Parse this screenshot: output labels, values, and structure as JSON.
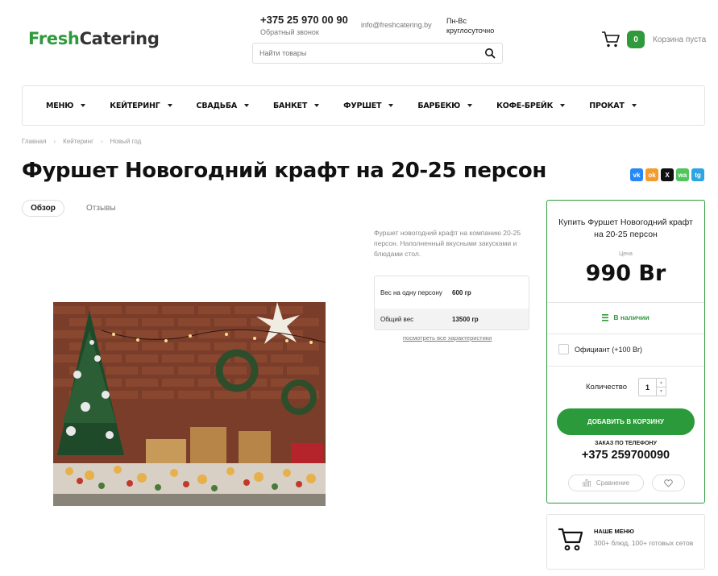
{
  "header": {
    "logo_fresh": "Fresh",
    "logo_catering": "Catering",
    "phone": "+375 25 970 00 90",
    "callback": "Обратный звонок",
    "email": "info@freshcatering.by",
    "hours": "Пн-Вс круглосуточно",
    "search_placeholder": "Найти товары",
    "cart_count": "0",
    "cart_empty": "Корзина пуста"
  },
  "nav": {
    "items": [
      "МЕНЮ",
      "КЕЙТЕРИНГ",
      "СВАДЬБА",
      "БАНКЕТ",
      "ФУРШЕТ",
      "БАРБЕКЮ",
      "КОФЕ-БРЕЙК",
      "ПРОКАТ"
    ]
  },
  "breadcrumb": [
    "Главная",
    "Кейтеринг",
    "Новый год"
  ],
  "product": {
    "title": "Фуршет Новогодний крафт на 20-25 персон",
    "description": "Фуршет новогодний крафт на компанию 20-25 персон. Наполненный вкусными закусками и блюдами стол.",
    "specs": [
      {
        "key": "Вес на одну персону",
        "value": "600 гр"
      },
      {
        "key": "Общий вес",
        "value": "13500 гр"
      }
    ],
    "all_chars": "посмотреть все характеристики"
  },
  "tabs": {
    "overview": "Обзор",
    "reviews": "Отзывы"
  },
  "share": {
    "vk": "vk",
    "ok": "ok",
    "x": "X",
    "wa": "wa",
    "tg": "tg"
  },
  "buy": {
    "title": "Купить Фуршет Новогодний крафт на 20-25 персон",
    "price_label": "Цена",
    "price": "990 Br",
    "stock": "В наличии",
    "waiter": "Официант (+100 Br)",
    "qty_label": "Количество",
    "qty": "1",
    "add_to_cart": "ДОБАВИТЬ В КОРЗИНУ",
    "phone_order_label": "ЗАКАЗ ПО ТЕЛЕФОНУ",
    "phone_order": "+375 259700090",
    "compare": "Сравнение"
  },
  "menu_panel": {
    "title": "НАШЕ МЕНЮ",
    "subtitle": "300+ блюд, 100+ готовых сетов"
  },
  "colors": {
    "brand_green": "#2f9a3b",
    "vk": "#2787f5",
    "ok": "#f59a2c",
    "x": "#111111",
    "wa": "#4fc55b",
    "tg": "#2ca5e0"
  }
}
